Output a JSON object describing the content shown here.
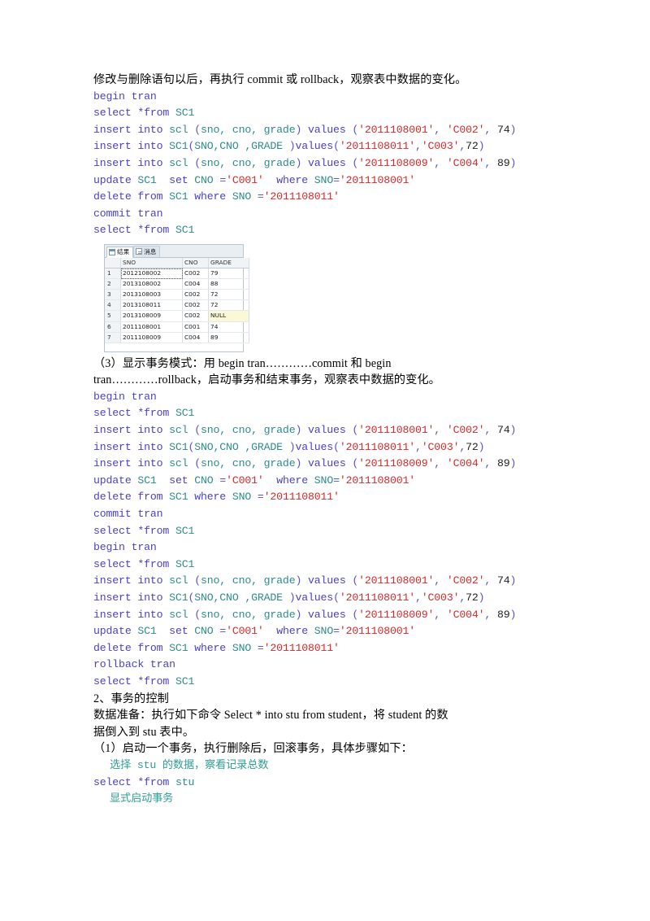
{
  "document": {
    "intro_paragraph": "修改与删除语句以后，再执行 commit 或 rollback，观察表中数据的变化。",
    "section3_paragraph": "（3）显示事务模式：用 begin tran…………commit 和 begin\ntran…………rollback，启动事务和结束事务，观察表中数据的变化。",
    "section2_heading": "2、事务的控制",
    "data_prep_paragraph": "数据准备：执行如下命令 Select * into stu from student，将 student 的数\n据倒入到 stu 表中。",
    "step1_paragraph": "（1）启动一个事务，执行删除后，回滚事务，具体步骤如下：",
    "comment_select_stu": "选择 stu 的数据，察看记录总数",
    "comment_begin_tran": "显式启动事务"
  },
  "sql_block_1": {
    "lines": [
      [
        {
          "t": "begin tran",
          "c": "kw"
        }
      ],
      [
        {
          "t": "select ",
          "c": "kw"
        },
        {
          "t": "*from ",
          "c": "kw"
        },
        {
          "t": "SC1",
          "c": "id"
        }
      ],
      [
        {
          "t": "insert into ",
          "c": "kw"
        },
        {
          "t": "scl ",
          "c": "id"
        },
        {
          "t": "(",
          "c": "punc"
        },
        {
          "t": "sno, cno, grade",
          "c": "id"
        },
        {
          "t": ") ",
          "c": "punc"
        },
        {
          "t": "values ",
          "c": "kw"
        },
        {
          "t": "(",
          "c": "punc"
        },
        {
          "t": "'2011108001'",
          "c": "str"
        },
        {
          "t": ", ",
          "c": "punc"
        },
        {
          "t": "'C002'",
          "c": "str"
        },
        {
          "t": ", ",
          "c": "punc"
        },
        {
          "t": "74",
          "c": "num"
        },
        {
          "t": ")",
          "c": "punc"
        }
      ],
      [
        {
          "t": "insert into ",
          "c": "kw"
        },
        {
          "t": "SC1",
          "c": "id"
        },
        {
          "t": "(",
          "c": "punc"
        },
        {
          "t": "SNO,CNO ,GRADE ",
          "c": "id"
        },
        {
          "t": ")",
          "c": "punc"
        },
        {
          "t": "values",
          "c": "kw"
        },
        {
          "t": "(",
          "c": "punc"
        },
        {
          "t": "'2011108011'",
          "c": "str"
        },
        {
          "t": ",",
          "c": "punc"
        },
        {
          "t": "'C003'",
          "c": "str"
        },
        {
          "t": ",",
          "c": "punc"
        },
        {
          "t": "72",
          "c": "num"
        },
        {
          "t": ")",
          "c": "punc"
        }
      ],
      [
        {
          "t": "insert into ",
          "c": "kw"
        },
        {
          "t": "scl ",
          "c": "id"
        },
        {
          "t": "(",
          "c": "punc"
        },
        {
          "t": "sno, cno, grade",
          "c": "id"
        },
        {
          "t": ") ",
          "c": "punc"
        },
        {
          "t": "values ",
          "c": "kw"
        },
        {
          "t": "(",
          "c": "punc"
        },
        {
          "t": "'2011108009'",
          "c": "str"
        },
        {
          "t": ", ",
          "c": "punc"
        },
        {
          "t": "'C004'",
          "c": "str"
        },
        {
          "t": ", ",
          "c": "punc"
        },
        {
          "t": "89",
          "c": "num"
        },
        {
          "t": ")",
          "c": "punc"
        }
      ],
      [
        {
          "t": "update ",
          "c": "kw"
        },
        {
          "t": "SC1",
          "c": "id"
        },
        {
          "t": "  set ",
          "c": "kw"
        },
        {
          "t": "CNO ",
          "c": "id"
        },
        {
          "t": "=",
          "c": "punc"
        },
        {
          "t": "'C001'",
          "c": "str"
        },
        {
          "t": "  where ",
          "c": "kw"
        },
        {
          "t": "SNO",
          "c": "id"
        },
        {
          "t": "=",
          "c": "punc"
        },
        {
          "t": "'2011108001'",
          "c": "str"
        }
      ],
      [
        {
          "t": "delete from ",
          "c": "kw"
        },
        {
          "t": "SC1 ",
          "c": "id"
        },
        {
          "t": "where ",
          "c": "kw"
        },
        {
          "t": "SNO ",
          "c": "id"
        },
        {
          "t": "=",
          "c": "punc"
        },
        {
          "t": "'2011108011'",
          "c": "str"
        }
      ],
      [
        {
          "t": "commit tran",
          "c": "kw"
        }
      ],
      [
        {
          "t": "select ",
          "c": "kw"
        },
        {
          "t": "*from ",
          "c": "kw"
        },
        {
          "t": "SC1",
          "c": "id"
        }
      ]
    ]
  },
  "sql_block_2": {
    "lines": [
      [
        {
          "t": "begin tran",
          "c": "kw"
        }
      ],
      [
        {
          "t": "select ",
          "c": "kw"
        },
        {
          "t": "*from ",
          "c": "kw"
        },
        {
          "t": "SC1",
          "c": "id"
        }
      ],
      [
        {
          "t": "insert into ",
          "c": "kw"
        },
        {
          "t": "scl ",
          "c": "id"
        },
        {
          "t": "(",
          "c": "punc"
        },
        {
          "t": "sno, cno, grade",
          "c": "id"
        },
        {
          "t": ") ",
          "c": "punc"
        },
        {
          "t": "values ",
          "c": "kw"
        },
        {
          "t": "(",
          "c": "punc"
        },
        {
          "t": "'2011108001'",
          "c": "str"
        },
        {
          "t": ", ",
          "c": "punc"
        },
        {
          "t": "'C002'",
          "c": "str"
        },
        {
          "t": ", ",
          "c": "punc"
        },
        {
          "t": "74",
          "c": "num"
        },
        {
          "t": ")",
          "c": "punc"
        }
      ],
      [
        {
          "t": "insert into ",
          "c": "kw"
        },
        {
          "t": "SC1",
          "c": "id"
        },
        {
          "t": "(",
          "c": "punc"
        },
        {
          "t": "SNO,CNO ,GRADE ",
          "c": "id"
        },
        {
          "t": ")",
          "c": "punc"
        },
        {
          "t": "values",
          "c": "kw"
        },
        {
          "t": "(",
          "c": "punc"
        },
        {
          "t": "'2011108011'",
          "c": "str"
        },
        {
          "t": ",",
          "c": "punc"
        },
        {
          "t": "'C003'",
          "c": "str"
        },
        {
          "t": ",",
          "c": "punc"
        },
        {
          "t": "72",
          "c": "num"
        },
        {
          "t": ")",
          "c": "punc"
        }
      ],
      [
        {
          "t": "insert into ",
          "c": "kw"
        },
        {
          "t": "scl ",
          "c": "id"
        },
        {
          "t": "(",
          "c": "punc"
        },
        {
          "t": "sno, cno, grade",
          "c": "id"
        },
        {
          "t": ") ",
          "c": "punc"
        },
        {
          "t": "values ",
          "c": "kw"
        },
        {
          "t": "(",
          "c": "punc"
        },
        {
          "t": "'2011108009'",
          "c": "str"
        },
        {
          "t": ", ",
          "c": "punc"
        },
        {
          "t": "'C004'",
          "c": "str"
        },
        {
          "t": ", ",
          "c": "punc"
        },
        {
          "t": "89",
          "c": "num"
        },
        {
          "t": ")",
          "c": "punc"
        }
      ],
      [
        {
          "t": "update ",
          "c": "kw"
        },
        {
          "t": "SC1",
          "c": "id"
        },
        {
          "t": "  set ",
          "c": "kw"
        },
        {
          "t": "CNO ",
          "c": "id"
        },
        {
          "t": "=",
          "c": "punc"
        },
        {
          "t": "'C001'",
          "c": "str"
        },
        {
          "t": "  where ",
          "c": "kw"
        },
        {
          "t": "SNO",
          "c": "id"
        },
        {
          "t": "=",
          "c": "punc"
        },
        {
          "t": "'2011108001'",
          "c": "str"
        }
      ],
      [
        {
          "t": "delete from ",
          "c": "kw"
        },
        {
          "t": "SC1 ",
          "c": "id"
        },
        {
          "t": "where ",
          "c": "kw"
        },
        {
          "t": "SNO ",
          "c": "id"
        },
        {
          "t": "=",
          "c": "punc"
        },
        {
          "t": "'2011108011'",
          "c": "str"
        }
      ],
      [
        {
          "t": "commit tran",
          "c": "kw"
        }
      ],
      [
        {
          "t": "select ",
          "c": "kw"
        },
        {
          "t": "*from ",
          "c": "kw"
        },
        {
          "t": "SC1",
          "c": "id"
        }
      ],
      [
        {
          "t": "begin tran",
          "c": "kw"
        }
      ],
      [
        {
          "t": "select ",
          "c": "kw"
        },
        {
          "t": "*from ",
          "c": "kw"
        },
        {
          "t": "SC1",
          "c": "id"
        }
      ],
      [
        {
          "t": "insert into ",
          "c": "kw"
        },
        {
          "t": "scl ",
          "c": "id"
        },
        {
          "t": "(",
          "c": "punc"
        },
        {
          "t": "sno, cno, grade",
          "c": "id"
        },
        {
          "t": ") ",
          "c": "punc"
        },
        {
          "t": "values ",
          "c": "kw"
        },
        {
          "t": "(",
          "c": "punc"
        },
        {
          "t": "'2011108001'",
          "c": "str"
        },
        {
          "t": ", ",
          "c": "punc"
        },
        {
          "t": "'C002'",
          "c": "str"
        },
        {
          "t": ", ",
          "c": "punc"
        },
        {
          "t": "74",
          "c": "num"
        },
        {
          "t": ")",
          "c": "punc"
        }
      ],
      [
        {
          "t": "insert into ",
          "c": "kw"
        },
        {
          "t": "SC1",
          "c": "id"
        },
        {
          "t": "(",
          "c": "punc"
        },
        {
          "t": "SNO,CNO ,GRADE ",
          "c": "id"
        },
        {
          "t": ")",
          "c": "punc"
        },
        {
          "t": "values",
          "c": "kw"
        },
        {
          "t": "(",
          "c": "punc"
        },
        {
          "t": "'2011108011'",
          "c": "str"
        },
        {
          "t": ",",
          "c": "punc"
        },
        {
          "t": "'C003'",
          "c": "str"
        },
        {
          "t": ",",
          "c": "punc"
        },
        {
          "t": "72",
          "c": "num"
        },
        {
          "t": ")",
          "c": "punc"
        }
      ],
      [
        {
          "t": "insert into ",
          "c": "kw"
        },
        {
          "t": "scl ",
          "c": "id"
        },
        {
          "t": "(",
          "c": "punc"
        },
        {
          "t": "sno, cno, grade",
          "c": "id"
        },
        {
          "t": ") ",
          "c": "punc"
        },
        {
          "t": "values ",
          "c": "kw"
        },
        {
          "t": "(",
          "c": "punc"
        },
        {
          "t": "'2011108009'",
          "c": "str"
        },
        {
          "t": ", ",
          "c": "punc"
        },
        {
          "t": "'C004'",
          "c": "str"
        },
        {
          "t": ", ",
          "c": "punc"
        },
        {
          "t": "89",
          "c": "num"
        },
        {
          "t": ")",
          "c": "punc"
        }
      ],
      [
        {
          "t": "update ",
          "c": "kw"
        },
        {
          "t": "SC1",
          "c": "id"
        },
        {
          "t": "  set ",
          "c": "kw"
        },
        {
          "t": "CNO ",
          "c": "id"
        },
        {
          "t": "=",
          "c": "punc"
        },
        {
          "t": "'C001'",
          "c": "str"
        },
        {
          "t": "  where ",
          "c": "kw"
        },
        {
          "t": "SNO",
          "c": "id"
        },
        {
          "t": "=",
          "c": "punc"
        },
        {
          "t": "'2011108001'",
          "c": "str"
        }
      ],
      [
        {
          "t": "delete from ",
          "c": "kw"
        },
        {
          "t": "SC1 ",
          "c": "id"
        },
        {
          "t": "where ",
          "c": "kw"
        },
        {
          "t": "SNO ",
          "c": "id"
        },
        {
          "t": "=",
          "c": "punc"
        },
        {
          "t": "'2011108011'",
          "c": "str"
        }
      ],
      [
        {
          "t": "rollback tran",
          "c": "kw"
        }
      ],
      [
        {
          "t": "select ",
          "c": "kw"
        },
        {
          "t": "*from ",
          "c": "kw"
        },
        {
          "t": "SC1",
          "c": "id"
        }
      ]
    ]
  },
  "sql_block_3": {
    "lines": [
      [
        {
          "t": "select ",
          "c": "kw"
        },
        {
          "t": "*from ",
          "c": "kw"
        },
        {
          "t": "stu",
          "c": "id"
        }
      ]
    ]
  },
  "results_grid": {
    "tabs": [
      {
        "label": "结果",
        "icon": "grid-icon",
        "active": true
      },
      {
        "label": "消息",
        "icon": "message-icon",
        "active": false
      }
    ],
    "columns": [
      "",
      "SNO",
      "CNO",
      "GRADE"
    ],
    "rows": [
      {
        "n": "1",
        "sno": "2012108002",
        "cno": "C002",
        "grade": "79",
        "selected": true,
        "null_grade": false
      },
      {
        "n": "2",
        "sno": "2013108002",
        "cno": "C004",
        "grade": "88",
        "selected": false,
        "null_grade": false
      },
      {
        "n": "3",
        "sno": "2013108003",
        "cno": "C002",
        "grade": "72",
        "selected": false,
        "null_grade": false
      },
      {
        "n": "4",
        "sno": "2013108011",
        "cno": "C002",
        "grade": "72",
        "selected": false,
        "null_grade": false
      },
      {
        "n": "5",
        "sno": "2013108009",
        "cno": "C002",
        "grade": "NULL",
        "selected": false,
        "null_grade": true
      },
      {
        "n": "6",
        "sno": "2011108001",
        "cno": "C001",
        "grade": "74",
        "selected": false,
        "null_grade": false
      },
      {
        "n": "7",
        "sno": "2011108009",
        "cno": "C004",
        "grade": "89",
        "selected": false,
        "null_grade": false
      }
    ]
  },
  "colors": {
    "keyword": "#4a41c4",
    "identifier": "#2e8b8b",
    "string": "#d42a2a",
    "comment": "#2f9e94",
    "null_highlight": "#fbf8d8"
  }
}
